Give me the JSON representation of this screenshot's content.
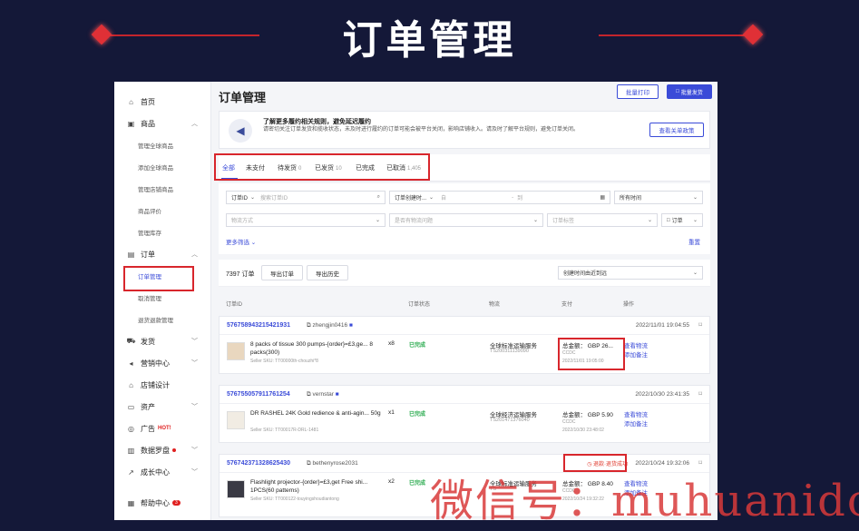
{
  "hero": {
    "title": "订单管理"
  },
  "sidebar": {
    "home": "首页",
    "products": "商品",
    "product_subs": [
      "管理全球商品",
      "添加全球商品",
      "管理店铺商品",
      "商品评价",
      "管理库存"
    ],
    "orders": "订单",
    "order_subs": [
      "订单管理",
      "取消管理",
      "退货退款管理"
    ],
    "shipping": "发货",
    "marketing": "营销中心",
    "store_design": "店铺设计",
    "assets": "资产",
    "ads": "广告",
    "ads_badge": "HOT!",
    "data": "数据罗盘",
    "growth": "成长中心",
    "help": "帮助中心",
    "help_badge": "3"
  },
  "header": {
    "title": "订单管理",
    "batch_print": "批量打印",
    "bulk_ship": "批量发货"
  },
  "notice": {
    "title": "了解更多履约相关规则，避免延迟履约",
    "desc": "请密切关注订单发货和揽收状态，未及时进行履约的订单可能会被平台关闭，影响店铺收入。请及时了解平台规则，避免订单关闭。",
    "button": "查看关单政策"
  },
  "tabs": [
    {
      "label": "全部",
      "count": ""
    },
    {
      "label": "未支付",
      "count": ""
    },
    {
      "label": "待发货",
      "count": "0"
    },
    {
      "label": "已发货",
      "count": "10"
    },
    {
      "label": "已完成",
      "count": ""
    },
    {
      "label": "已取消",
      "count": "1,405"
    }
  ],
  "filters": {
    "order_id_label": "订单ID",
    "order_id_placeholder": "搜索订单ID",
    "created_label": "订单创建时...",
    "start_placeholder": "自",
    "to": "-",
    "end_placeholder": "到",
    "time_range": "所有时间",
    "shipping_placeholder": "物流方式",
    "pickup_placeholder": "是否有物流问题",
    "tag_placeholder": "订单标签",
    "tag_btn": "订单",
    "more": "更多筛选",
    "reset": "重置"
  },
  "list": {
    "count": "7397 订单",
    "export": "导出订单",
    "history": "导出历史",
    "sort": "创建时间由近到远"
  },
  "columns": {
    "id": "订单ID",
    "status": "订单状态",
    "shipping": "物流",
    "payment": "支付",
    "actions": "操作"
  },
  "orders": [
    {
      "id": "576758943215421931",
      "user": "zhengjin0416",
      "date": "2022/11/01 19:04:55",
      "product": "8 packs of tissue 300 pumps-{order}=£3,ge... 8 packs(300)",
      "qty": "x8",
      "sku": "Seller SKU: TT00000th-chouzhi*8",
      "status": "已完成",
      "ship": "全球标准运输服务",
      "tracking": "TS200311139090",
      "total": "总金额：  GBP 26...",
      "currency": "CCDC",
      "pay_date": "2022/11/01 19:05:00",
      "act1": "查看物流",
      "act2": "添加备注"
    },
    {
      "id": "576755057911761254",
      "user": "vernstar",
      "date": "2022/10/30 23:41:35",
      "product": "DR RASHEL 24K Gold redience & anti-agin... 50g",
      "qty": "x1",
      "sku": "Seller SKU: TT00017R-DRL-1481",
      "status": "已完成",
      "ship": "全球经济运输服务",
      "tracking": "TS201471376040",
      "total": "总金额：  GBP 5.90",
      "currency": "CCDC",
      "pay_date": "2022/10/30 23:48:02",
      "act1": "查看物流",
      "act2": "添加备注"
    },
    {
      "id": "576742371328625430",
      "user": "bethenyrose2031",
      "date": "2022/10/24 19:32:06",
      "refund": "退款·退货成功",
      "product": "Flashlight projector-{order}=£3,get Free shi... 1PCS(60 patterns)",
      "qty": "x2",
      "sku": "Seller SKU: TT000122-touyingshoudiantong",
      "status": "已完成",
      "ship": "全球标准运输服务",
      "tracking": "TS",
      "total": "总金额：  GBP 8.40",
      "currency": "CCDC",
      "pay_date": "2022/10/24 19:32:22",
      "act1": "查看物流",
      "act2": "添加备注"
    }
  ],
  "watermark": "微信号：muhuanidc",
  "colors": {
    "accent": "#3a4bd8",
    "highlight": "#d8262c",
    "bg": "#141838",
    "success": "#2bab4f"
  }
}
